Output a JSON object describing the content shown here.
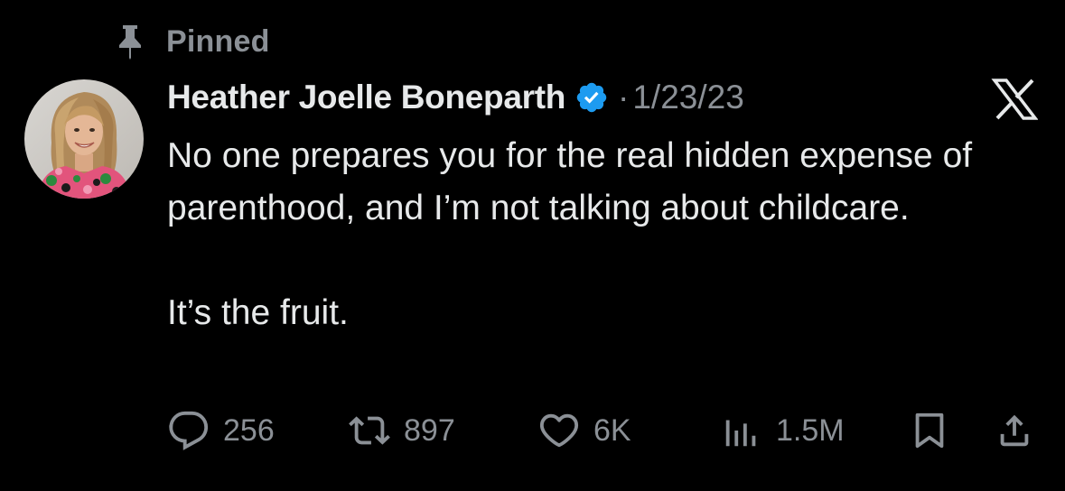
{
  "pinned": {
    "icon": "pin-icon",
    "label": "Pinned"
  },
  "author": {
    "name": "Heather Joelle Boneparth",
    "verified_icon": "verified-badge-icon",
    "verified_color": "#1d9bf0",
    "separator": "·",
    "timestamp": "1/23/23"
  },
  "brand": {
    "icon": "x-logo-icon"
  },
  "tweet": {
    "paragraph_1": "No one prepares you for the real hidden expense of parenthood, and I’m not talking about childcare.",
    "paragraph_2": "It’s the fruit."
  },
  "actions": {
    "reply": {
      "icon": "reply-icon",
      "count": "256"
    },
    "retweet": {
      "icon": "retweet-icon",
      "count": "897"
    },
    "like": {
      "icon": "heart-icon",
      "count": "6K"
    },
    "views": {
      "icon": "views-chart-icon",
      "count": "1.5M"
    },
    "bookmark": {
      "icon": "bookmark-icon"
    },
    "share": {
      "icon": "share-icon"
    }
  },
  "colors": {
    "background": "#000000",
    "text_primary": "#e7e9ea",
    "text_secondary": "#8b9096"
  }
}
